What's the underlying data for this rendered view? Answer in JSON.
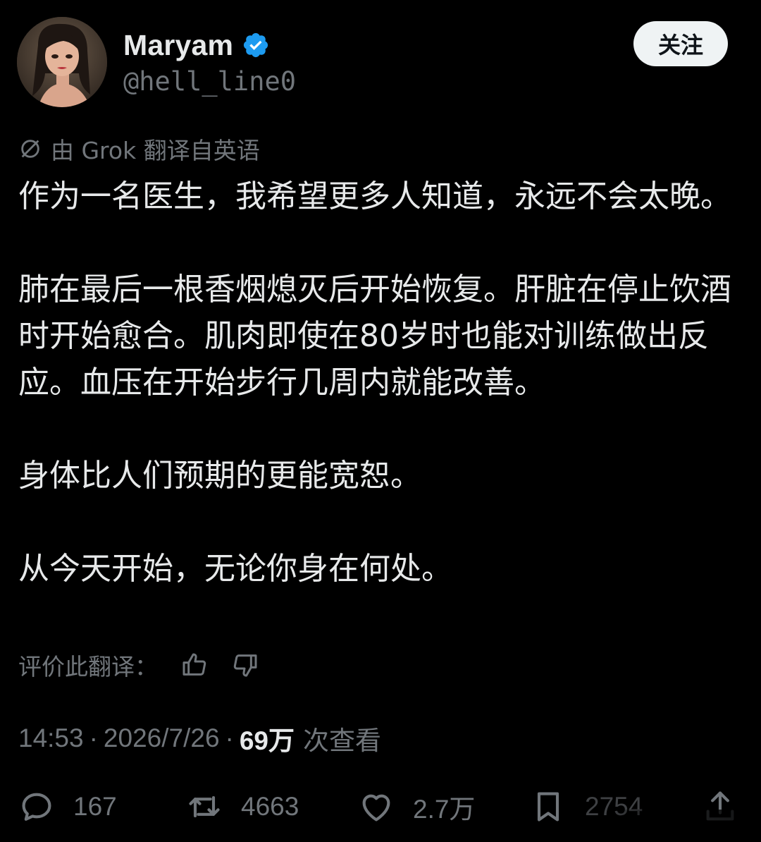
{
  "author": {
    "display_name": "Maryam",
    "handle": "@hell_line0",
    "verified": true,
    "avatar_icon": "avatar"
  },
  "follow_button": {
    "label": "关注"
  },
  "translation_note": {
    "text": "由 Grok 翻译自英语",
    "icon": "grok-icon"
  },
  "tweet": {
    "paragraphs": [
      "作为一名医生，我希望更多人知道，永远不会太晚。",
      "肺在最后一根香烟熄灭后开始恢复。肝脏在停止饮酒时开始愈合。肌肉即使在80岁时也能对训练做出反应。血压在开始步行几周内就能改善。",
      "身体比人们预期的更能宽恕。",
      "从今天开始，无论你身在何处。"
    ]
  },
  "rate_translation": {
    "label": "评价此翻译：",
    "icons": [
      "thumbs-up-icon",
      "thumbs-down-icon"
    ]
  },
  "meta": {
    "time": "14:53",
    "separator": "·",
    "date": "2026/7/26",
    "views_count": "69万",
    "views_label": "次查看"
  },
  "actions": {
    "reply_count": "167",
    "retweet_count": "4663",
    "like_count": "2.7万",
    "bookmark_count": "2754"
  },
  "colors": {
    "background": "#000000",
    "text": "#e7e9ea",
    "secondary": "#71767b",
    "verified": "#1d9bf0",
    "button_bg": "#eff3f4"
  }
}
